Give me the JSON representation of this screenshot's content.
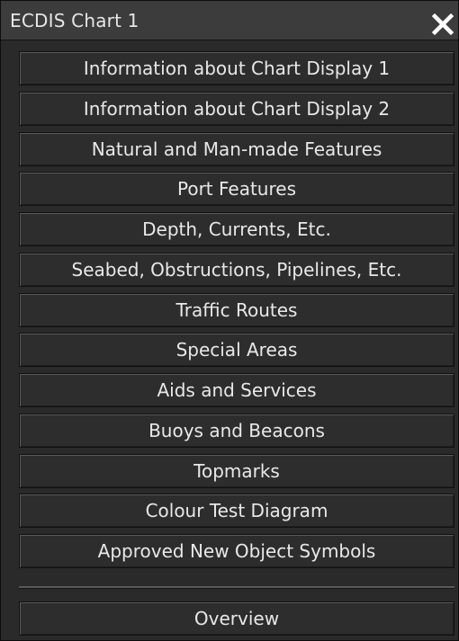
{
  "window": {
    "title": "ECDIS Chart 1",
    "close_icon": "close-icon"
  },
  "menu": {
    "items": [
      {
        "label": "Information about Chart Display 1"
      },
      {
        "label": "Information about Chart Display 2"
      },
      {
        "label": "Natural and Man-made Features"
      },
      {
        "label": "Port Features"
      },
      {
        "label": "Depth, Currents, Etc."
      },
      {
        "label": "Seabed, Obstructions, Pipelines, Etc."
      },
      {
        "label": "Traffic Routes"
      },
      {
        "label": "Special Areas"
      },
      {
        "label": "Aids and Services"
      },
      {
        "label": "Buoys and Beacons"
      },
      {
        "label": "Topmarks"
      },
      {
        "label": "Colour Test Diagram"
      },
      {
        "label": "Approved New Object Symbols"
      }
    ],
    "overview_label": "Overview"
  },
  "colors": {
    "background": "#2a2a2a",
    "button": "#2d2d2d",
    "text": "#e8e8e8",
    "titlebar": "#3c3c3c"
  }
}
